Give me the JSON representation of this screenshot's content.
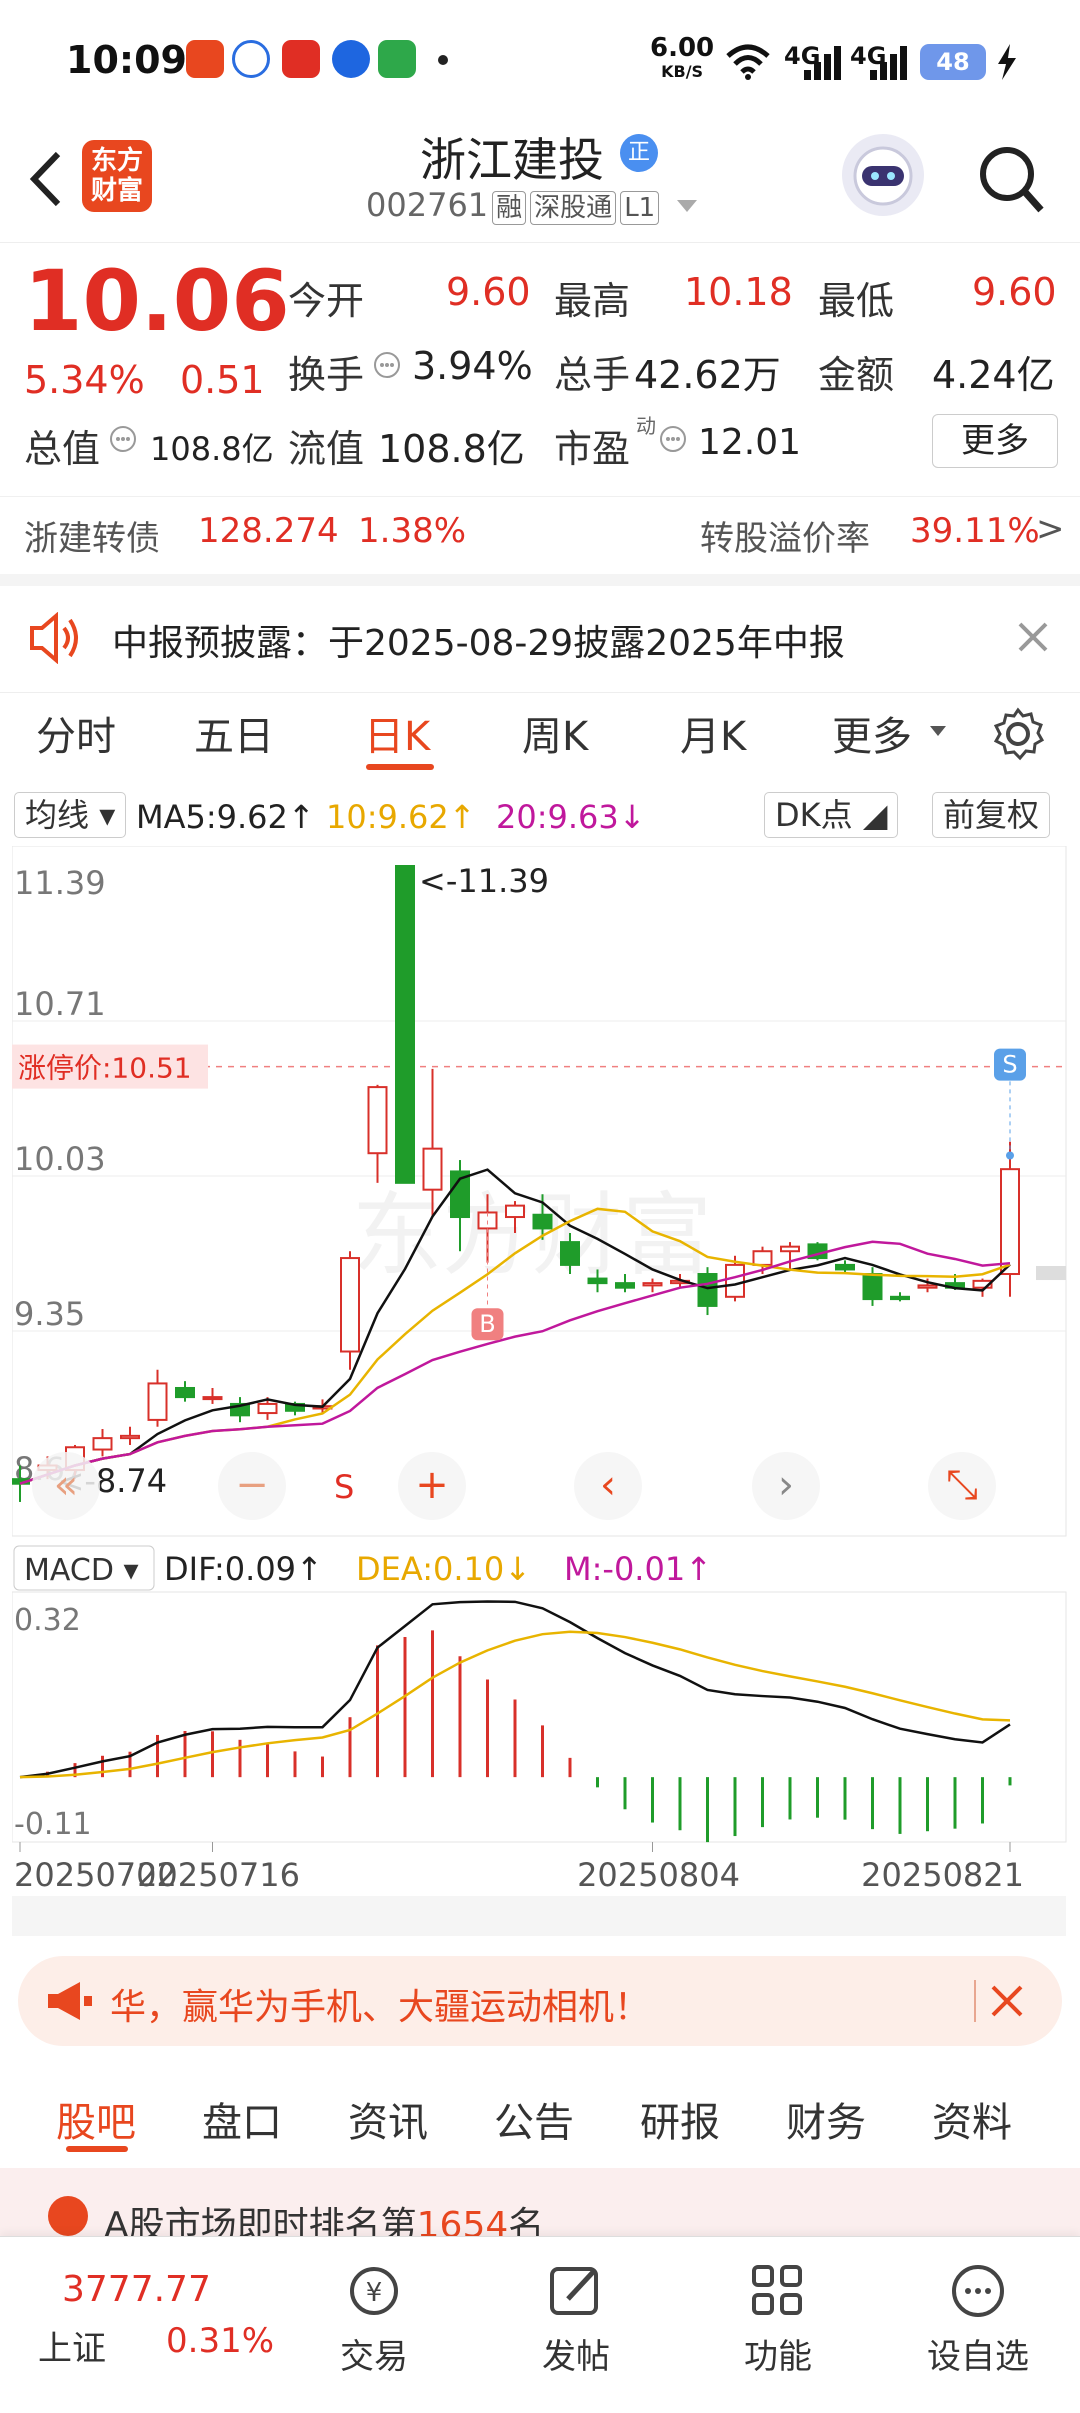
{
  "status_bar": {
    "time": "10:09",
    "net_speed": "6.00",
    "net_unit": "KB/S",
    "sig1": "4G",
    "sig2": "4G",
    "battery": "48"
  },
  "header": {
    "logo_line1": "东方",
    "logo_line2": "财富",
    "stock_name": "浙江建投",
    "badge": "正",
    "code": "002761",
    "tags": [
      "融",
      "深股通",
      "L1"
    ]
  },
  "quote": {
    "price": "10.06",
    "change_pct": "5.34%",
    "change": "0.51",
    "open_label": "今开",
    "open": "9.60",
    "high_label": "最高",
    "high": "10.18",
    "low_label": "最低",
    "low": "9.60",
    "turnover_label": "换手",
    "turnover": "3.94%",
    "volume_label": "总手",
    "volume": "42.62万",
    "amount_label": "金额",
    "amount": "4.24亿",
    "mcap_label": "总值",
    "mcap": "108.8亿",
    "float_label": "流值",
    "float_cap": "108.8亿",
    "pe_label": "市盈",
    "pe_sup": "动",
    "pe": "12.01",
    "more_label": "更多"
  },
  "convertible": {
    "name": "浙建转债",
    "price": "128.274",
    "change": "1.38%",
    "premium_label": "转股溢价率",
    "premium": "39.11%"
  },
  "notice": {
    "text": "中报预披露：于2025-08-29披露2025年中报"
  },
  "chart_tabs": [
    "分时",
    "五日",
    "日K",
    "周K",
    "月K",
    "更多"
  ],
  "active_chart_tab": "日K",
  "kline": {
    "ma_selector": "均线",
    "ma5": "MA5:9.62↑",
    "ma10": "10:9.62↑",
    "ma20": "20:9.63↓",
    "dk_button": "DK点",
    "adjust_button": "前复权",
    "y_ticks": [
      "11.39",
      "10.71",
      "10.03",
      "9.35",
      "8.67"
    ],
    "limit_label": "涨停价:10.51",
    "max_label": "<-11.39",
    "min_label": "<-8.74",
    "b_marker": "B",
    "s_marker": "S",
    "s_marker_low": "S",
    "macd_selector": "MACD",
    "dif": "DIF:0.09↑",
    "dea": "DEA:0.10↓",
    "m": "M:-0.01↑",
    "macd_ticks": [
      "0.32",
      "-0.11"
    ],
    "dates": [
      "20250702",
      "20250716",
      "20250804",
      "20250821"
    ],
    "watermark": "东方财富"
  },
  "chart_data": {
    "type": "candlestick",
    "ylim": [
      8.67,
      11.39
    ],
    "candles": [
      {
        "o": 8.7,
        "h": 8.76,
        "l": 8.6,
        "c": 8.68
      },
      {
        "o": 8.74,
        "h": 8.8,
        "l": 8.7,
        "c": 8.76
      },
      {
        "o": 8.74,
        "h": 8.85,
        "l": 8.7,
        "c": 8.84
      },
      {
        "o": 8.83,
        "h": 8.92,
        "l": 8.8,
        "c": 8.88
      },
      {
        "o": 8.88,
        "h": 8.93,
        "l": 8.85,
        "c": 8.89
      },
      {
        "o": 8.96,
        "h": 9.18,
        "l": 8.93,
        "c": 9.12
      },
      {
        "o": 9.1,
        "h": 9.13,
        "l": 9.04,
        "c": 9.06
      },
      {
        "o": 9.06,
        "h": 9.1,
        "l": 9.03,
        "c": 9.06
      },
      {
        "o": 9.03,
        "h": 9.06,
        "l": 8.95,
        "c": 8.98
      },
      {
        "o": 8.99,
        "h": 9.06,
        "l": 8.96,
        "c": 9.03
      },
      {
        "o": 9.03,
        "h": 9.04,
        "l": 8.98,
        "c": 9.0
      },
      {
        "o": 9.01,
        "h": 9.05,
        "l": 8.99,
        "c": 9.02
      },
      {
        "o": 9.26,
        "h": 9.7,
        "l": 9.18,
        "c": 9.67
      },
      {
        "o": 10.13,
        "h": 10.43,
        "l": 10.0,
        "c": 10.42
      },
      {
        "o": 11.39,
        "h": 11.39,
        "l": 10.0,
        "c": 10.0
      },
      {
        "o": 9.97,
        "h": 10.5,
        "l": 9.85,
        "c": 10.15
      },
      {
        "o": 10.05,
        "h": 10.1,
        "l": 9.7,
        "c": 9.85
      },
      {
        "o": 9.8,
        "h": 9.95,
        "l": 9.65,
        "c": 9.87
      },
      {
        "o": 9.85,
        "h": 9.92,
        "l": 9.78,
        "c": 9.9
      },
      {
        "o": 9.86,
        "h": 9.95,
        "l": 9.75,
        "c": 9.8
      },
      {
        "o": 9.74,
        "h": 9.78,
        "l": 9.6,
        "c": 9.64
      },
      {
        "o": 9.58,
        "h": 9.62,
        "l": 9.52,
        "c": 9.56
      },
      {
        "o": 9.56,
        "h": 9.6,
        "l": 9.52,
        "c": 9.54
      },
      {
        "o": 9.55,
        "h": 9.58,
        "l": 9.52,
        "c": 9.56
      },
      {
        "o": 9.56,
        "h": 9.6,
        "l": 9.54,
        "c": 9.57
      },
      {
        "o": 9.6,
        "h": 9.63,
        "l": 9.42,
        "c": 9.46
      },
      {
        "o": 9.5,
        "h": 9.68,
        "l": 9.48,
        "c": 9.64
      },
      {
        "o": 9.64,
        "h": 9.72,
        "l": 9.6,
        "c": 9.7
      },
      {
        "o": 9.7,
        "h": 9.74,
        "l": 9.62,
        "c": 9.72
      },
      {
        "o": 9.73,
        "h": 9.74,
        "l": 9.66,
        "c": 9.67
      },
      {
        "o": 9.64,
        "h": 9.66,
        "l": 9.6,
        "c": 9.62
      },
      {
        "o": 9.6,
        "h": 9.63,
        "l": 9.46,
        "c": 9.49
      },
      {
        "o": 9.5,
        "h": 9.52,
        "l": 9.48,
        "c": 9.49
      },
      {
        "o": 9.54,
        "h": 9.58,
        "l": 9.52,
        "c": 9.55
      },
      {
        "o": 9.56,
        "h": 9.6,
        "l": 9.53,
        "c": 9.54
      },
      {
        "o": 9.54,
        "h": 9.58,
        "l": 9.5,
        "c": 9.57
      },
      {
        "o": 9.6,
        "h": 10.18,
        "l": 9.5,
        "c": 10.06
      }
    ],
    "limit_price": 10.51,
    "macd_ylim": [
      -0.11,
      0.32
    ]
  },
  "ad": {
    "text": "华，赢华为手机、大疆运动相机！"
  },
  "bottom_tabs": [
    "股吧",
    "盘口",
    "资讯",
    "公告",
    "研报",
    "财务",
    "资料"
  ],
  "active_bottom_tab": "股吧",
  "peek": {
    "text_prefix": "A股市场即时排名第",
    "rank": "1654",
    "text_suffix": "名"
  },
  "bottom_nav": {
    "index_value": "3777.77",
    "index_name": "上证",
    "index_change": "0.31%",
    "items": [
      "交易",
      "发帖",
      "功能",
      "设自选"
    ]
  }
}
